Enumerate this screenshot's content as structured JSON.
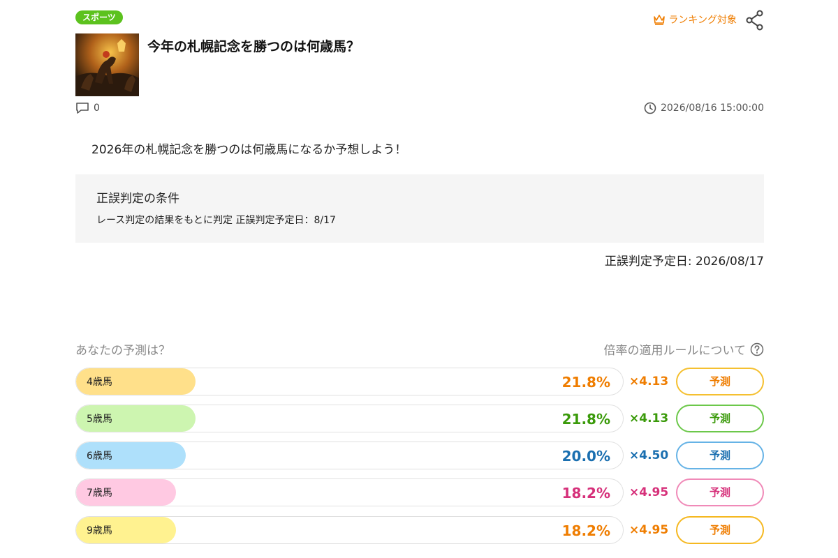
{
  "category": "スポーツ",
  "ranking_label": "ランキング対象",
  "title": "今年の札幌記念を勝つのは何歳馬？",
  "comment_count": "0",
  "datetime": "2026/08/16 15:00:00",
  "description": "2026年の札幌記念を勝つのは何歳馬になるか予想しよう！",
  "conditions": {
    "title": "正誤判定の条件",
    "text": "レース判定の結果をもとに判定 正誤判定予定日：8/17"
  },
  "judge_date": "正誤判定予定日: 2026/08/17",
  "prediction_heading": "あなたの予測は？",
  "odds_rule_label": "倍率の適用ルールについて",
  "options": [
    {
      "label": "4歳馬",
      "percent": "21.8%",
      "multiplier": "×4.13",
      "button": "予測",
      "share": 0.218,
      "fill_color": "#ffe08a",
      "accent": "#ef7d00",
      "border": "#f5c030"
    },
    {
      "label": "5歳馬",
      "percent": "21.8%",
      "multiplier": "×4.13",
      "button": "予測",
      "share": 0.218,
      "fill_color": "#cdf5b0",
      "accent": "#3a9a0a",
      "border": "#6cc84a"
    },
    {
      "label": "6歳馬",
      "percent": "20.0%",
      "multiplier": "×4.50",
      "button": "予測",
      "share": 0.2,
      "fill_color": "#aee0fb",
      "accent": "#1a6fb0",
      "border": "#66b3e6"
    },
    {
      "label": "7歳馬",
      "percent": "18.2%",
      "multiplier": "×4.95",
      "button": "予測",
      "share": 0.182,
      "fill_color": "#ffc9e2",
      "accent": "#d6307a",
      "border": "#f08ab8"
    },
    {
      "label": "9歳馬",
      "percent": "18.2%",
      "multiplier": "×4.95",
      "button": "予測",
      "share": 0.182,
      "fill_color": "#fff290",
      "accent": "#ef7d00",
      "border": "#f5b820"
    }
  ]
}
